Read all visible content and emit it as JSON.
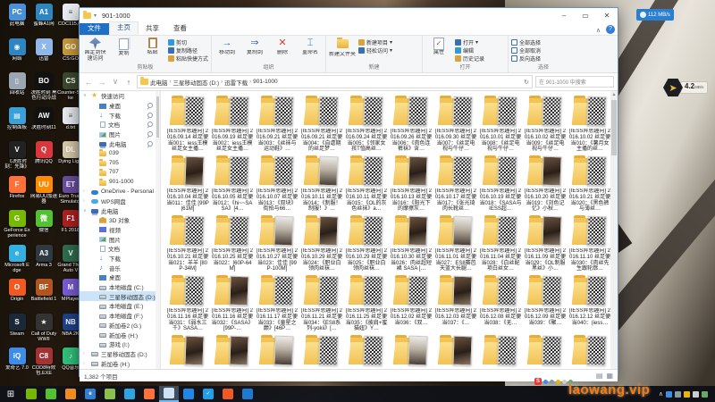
{
  "overlays": {
    "net_badge": "112 MB/s",
    "dl_speed": "4.2",
    "dl_unit": "MB/s",
    "tray_brand": "S",
    "watermark": "laowang.vip"
  },
  "window": {
    "title": "901-1000",
    "menu_file": "文件",
    "tabs": [
      "主页",
      "共享",
      "查看"
    ],
    "ribbon": {
      "clipboard": {
        "label": "剪贴板",
        "pin": "固定到快速访问",
        "copy": "复制",
        "paste": "粘贴",
        "cut": "剪切",
        "copy_path": "复制路径",
        "paste_shortcut": "粘贴快捷方式"
      },
      "organize": {
        "label": "组织",
        "move": "移动到",
        "copyto": "复制到",
        "del": "删除",
        "rename": "重命名"
      },
      "new": {
        "label": "新建",
        "folder": "新建文件夹",
        "item": "新建项目",
        "easy": "轻松访问"
      },
      "open": {
        "label": "打开",
        "props": "属性",
        "open": "打开",
        "edit": "编辑",
        "history": "历史记录"
      },
      "select": {
        "label": "选择",
        "all": "全部选择",
        "none": "全部取消",
        "invert": "反向选择"
      }
    },
    "address": {
      "crumbs": [
        "此电脑",
        "三星移动固态 (D:)",
        "迅雷下载",
        "901-1000"
      ],
      "search_placeholder": "在 901-1000 中搜索"
    },
    "status": {
      "count": "1,382 个项目"
    }
  },
  "sidebar": {
    "items": [
      {
        "t": "快速访问",
        "ic": "star",
        "ind": 0,
        "ar": "v"
      },
      {
        "t": "桌面",
        "ic": "desktop",
        "ind": 1,
        "pin": true
      },
      {
        "t": "下载",
        "ic": "download",
        "ind": 1,
        "pin": true
      },
      {
        "t": "文档",
        "ic": "doc",
        "ind": 1,
        "pin": true
      },
      {
        "t": "图片",
        "ic": "pic",
        "ind": 1,
        "pin": true
      },
      {
        "t": "此电脑",
        "ic": "pc",
        "ind": 1,
        "pin": true
      },
      {
        "t": "039",
        "ic": "folder",
        "ind": 1
      },
      {
        "t": "705",
        "ic": "folder",
        "ind": 1
      },
      {
        "t": "707",
        "ic": "folder",
        "ind": 1
      },
      {
        "t": "901-1000",
        "ic": "folder",
        "ind": 1
      },
      {
        "t": "OneDrive - Personal",
        "ic": "cloud",
        "ind": 0,
        "ar": ">"
      },
      {
        "t": "WPS网盘",
        "ic": "cloud2",
        "ind": 0,
        "ar": ">"
      },
      {
        "t": "此电脑",
        "ic": "pc",
        "ind": 0,
        "ar": "v"
      },
      {
        "t": "3D 对象",
        "ic": "obj",
        "ind": 1
      },
      {
        "t": "视频",
        "ic": "video",
        "ind": 1
      },
      {
        "t": "图片",
        "ic": "pic",
        "ind": 1
      },
      {
        "t": "文档",
        "ic": "doc",
        "ind": 1
      },
      {
        "t": "下载",
        "ic": "download",
        "ind": 1
      },
      {
        "t": "音乐",
        "ic": "music",
        "ind": 1
      },
      {
        "t": "桌面",
        "ic": "desktop",
        "ind": 1
      },
      {
        "t": "本地磁盘 (C:)",
        "ic": "drive",
        "ind": 1
      },
      {
        "t": "三星移动固态 (D:)",
        "ic": "drive",
        "ind": 1,
        "sel": true
      },
      {
        "t": "本地磁盘 (E:)",
        "ic": "drive",
        "ind": 1
      },
      {
        "t": "本地磁盘 (F:)",
        "ic": "drive",
        "ind": 1
      },
      {
        "t": "新加卷2 (G:)",
        "ic": "drive",
        "ind": 1
      },
      {
        "t": "新加卷 (H:)",
        "ic": "drive",
        "ind": 1
      },
      {
        "t": "游戏 (I:)",
        "ic": "drive",
        "ind": 1
      },
      {
        "t": "三星移动固态 (D:)",
        "ic": "drive",
        "ind": 0,
        "ar": ">"
      },
      {
        "t": "新加卷 (H:)",
        "ic": "drive",
        "ind": 0,
        "ar": ">"
      }
    ]
  },
  "files": [
    {
      "n": "[IESS异思趣向] 2016.09.14 丝足便当001：iess王模丝足女主播…",
      "t": "q"
    },
    {
      "n": "[IESS异思趣向] 2016.09.19 丝足便当002：iess王模丝足女主播…",
      "t": "q"
    },
    {
      "n": "[IESS异思趣向] 2016.09.21 丝足便当003：《丝袜与运动鞋》…",
      "t": "q"
    },
    {
      "n": "[IESS异思趣向] 2016.09.21 丝足便当004：《自虐期的丝足梦…",
      "t": "q"
    },
    {
      "n": "[IESS异思趣向] 2016.09.24 丝足便当005：《邻家女孩T恤高丝…",
      "t": "q"
    },
    {
      "n": "[IESS异思趣向] 2016.09.26 丝足便当006：《肉色连裤袜》含…",
      "t": "q"
    },
    {
      "n": "[IESS异思趣向] 2016.09.30 丝足便当007：《丝足电视与牛仔…",
      "t": "q"
    },
    {
      "n": "[IESS异思趣向] 2016.10.01 丝足便当008：《丝足电视与牛仔…",
      "t": "q"
    },
    {
      "n": "[IESS异思趣向] 2016.10.02 丝足便当009：《丝足电视与牛仔…",
      "t": "q"
    },
    {
      "n": "[IESS异思趣向] 2016.10.02 丝足便当010：《薯月女主播的丝…",
      "t": "q"
    },
    {
      "n": "[IESS异思趣向] 2016.10.04 丝足便当011：佳佳 [99P|61M]",
      "t": "pd"
    },
    {
      "n": "[IESS异思趣向] 2016.10.05 丝足便当012：《hi~~SASA》[4…",
      "t": "q"
    },
    {
      "n": "[IESS异思趣向] 2016.10.07 丝足便当013：《双块》街拍与66…",
      "t": "q"
    },
    {
      "n": "[IESS异思趣向] 2016.10.11 丝足便当014：《制服！制服！》…",
      "t": "pl"
    },
    {
      "n": "[IESS异思趣向] 2016.10.11 丝足便当015：《OL的灰色丝袜》a…",
      "t": "q"
    },
    {
      "n": "[IESS异思趣向] 2016.10.13 丝足便当016：《阳光下的摩擦灰…",
      "t": "pd"
    },
    {
      "n": "[IESS异思趣向] 2016.10.17 丝足便当017：《张光琦肉长靴丝…",
      "t": "q"
    },
    {
      "n": "[IESS异思趣向] 2016.10.19 丝足便当018：《SASA与IESS超…",
      "t": "q"
    },
    {
      "n": "[IESS异思趣向] 2016.10.20 丝足便当019：《刘色记忆》小秋…",
      "t": "pd"
    },
    {
      "n": "[IESS异思趣向] 2016.10.21 丝足便当020：《黑色裤与薄丝…",
      "t": "q"
    },
    {
      "n": "[IESS异思趣向] 2016.10.21 丝足便当021：羊羊 [80P-34M]",
      "t": "q"
    },
    {
      "n": "[IESS异思趣向] 2016.10.25 丝足便当022：[60P-64M]",
      "t": "q"
    },
    {
      "n": "[IESS异思趣向] 2016.10.27 丝足便当023：佳佳 [99P-100M]",
      "t": "pl"
    },
    {
      "n": "[IESS异思趣向] 2016.10.29 丝足便当024：《职业白领肉丝袜…",
      "t": "pd"
    },
    {
      "n": "[IESS异思趣向] 2016.10.29 丝足便当025：《职业白领肉丝袜…",
      "t": "q"
    },
    {
      "n": "[IESS异思趣向] 2016.10.30 丝足便当026：肉丝超短裙 SASA […",
      "t": "pd"
    },
    {
      "n": "[IESS异思趣向] 2016.11.01 丝足便当027：ES8赛芭天蓝大长腿…",
      "t": "pl"
    },
    {
      "n": "[IESS异思趣向] 2016.11.04 丝足便当028：《白丝配项白丝女…",
      "t": "q"
    },
    {
      "n": "[IESS异思趣向] 2016.11.09 丝足便当029：《OL制服黑丝》小…",
      "t": "pd"
    },
    {
      "n": "[IESS异思趣向] 2016.11.10 丝足便当030：《肉丝先生跟轮廓…",
      "t": "q"
    },
    {
      "n": "[IESS异思趣向] 2016.11.16 丝足便当031：《弱水三千》SASA…",
      "t": "q"
    },
    {
      "n": "[IESS异思趣向] 2016.11.16 丝足便当032：《SASA》[99P-…",
      "t": "pd"
    },
    {
      "n": "[IESS异思趣向] 2016.11.17 丝足便当033：《童星之巅》[46P…",
      "t": "q"
    },
    {
      "n": "[IESS异思趣向] 2016.11.21 丝足便当034：《ES8系列-yokii》[…",
      "t": "q"
    },
    {
      "n": "[IESS异思趣向] 2016.11.25 丝足便当035：《披肩+蜜猫妞》Y…",
      "t": "q"
    },
    {
      "n": "[IESS异思趣向] 2016.12.02 丝足便当036：《双…",
      "t": "q"
    },
    {
      "n": "[IESS异思趣向] 2016.12.03 丝足便当037：《…",
      "t": "pd"
    },
    {
      "n": "[IESS异思趣向] 2016.12.08 丝足便当038：《无…",
      "t": "q"
    },
    {
      "n": "[IESS异思趣向] 2016.12.09 丝足便当039：《聚…",
      "t": "q"
    },
    {
      "n": "[IESS异思趣向] 2016.12.12 丝足便当040：(iess…",
      "t": "q"
    },
    {
      "n": "",
      "t": "pd"
    },
    {
      "n": "",
      "t": "pd"
    },
    {
      "n": "",
      "t": "pl"
    },
    {
      "n": "",
      "t": "q"
    },
    {
      "n": "",
      "t": "q"
    },
    {
      "n": "",
      "t": "pl"
    },
    {
      "n": "",
      "t": "pd"
    },
    {
      "n": "",
      "t": "q"
    },
    {
      "n": "",
      "t": "q"
    },
    {
      "n": "",
      "t": "q"
    }
  ],
  "desktop": {
    "icons": [
      {
        "label": "此电脑",
        "c": "#4a90d9",
        "g": "PC",
        "col": 0,
        "row": 0
      },
      {
        "label": "蜜蜂A1网",
        "c": "#2e86c1",
        "g": "A1",
        "col": 1,
        "row": 0
      },
      {
        "label": "COC115.txt",
        "c": "#e8ecf0",
        "g": "≡",
        "col": 2,
        "row": 0
      },
      {
        "label": "网络",
        "c": "#2e86c1",
        "g": "◉",
        "col": 0,
        "row": 1
      },
      {
        "label": "迅雷",
        "c": "#8fb7e8",
        "g": "X",
        "col": 1,
        "row": 1
      },
      {
        "label": "CS:GO",
        "c": "#c79b3b",
        "g": "GO",
        "col": 2,
        "row": 1
      },
      {
        "label": "回收站",
        "c": "#9aa6b2",
        "g": "▯",
        "col": 0,
        "row": 2
      },
      {
        "label": "决胜时刻 黑色行动冷战",
        "c": "#111111",
        "g": "BO",
        "col": 1,
        "row": 2
      },
      {
        "label": "Counter-Strike",
        "c": "#3b4a2f",
        "g": "CS",
        "col": 2,
        "row": 2
      },
      {
        "label": "控制面板",
        "c": "#3aa0d8",
        "g": "▤",
        "col": 0,
        "row": 3
      },
      {
        "label": "决胜时刻11",
        "c": "#111111",
        "g": "AW",
        "col": 1,
        "row": 3
      },
      {
        "label": "d.txt",
        "c": "#e8ecf0",
        "g": "≡",
        "col": 2,
        "row": 3
      },
      {
        "label": "《决胜时刻：先锋》",
        "c": "#222222",
        "g": "V",
        "col": 0,
        "row": 4
      },
      {
        "label": "腾讯QQ",
        "c": "#d9363e",
        "g": "Q",
        "col": 1,
        "row": 4
      },
      {
        "label": "Dying Light",
        "c": "#d7c9a8",
        "g": "DL",
        "col": 2,
        "row": 4
      },
      {
        "label": "Firefox",
        "c": "#ff7139",
        "g": "F",
        "col": 0,
        "row": 5
      },
      {
        "label": "网易UU加速器",
        "c": "#ff8a00",
        "g": "UU",
        "col": 1,
        "row": 5
      },
      {
        "label": "Euro Truck Simulator",
        "c": "#6b4ea0",
        "g": "ET",
        "col": 2,
        "row": 5
      },
      {
        "label": "GeForce Experience",
        "c": "#76b900",
        "g": "G",
        "col": 0,
        "row": 6
      },
      {
        "label": "微信",
        "c": "#51c332",
        "g": "微",
        "col": 1,
        "row": 6
      },
      {
        "label": "F1 2018",
        "c": "#b02020",
        "g": "F1",
        "col": 2,
        "row": 6
      },
      {
        "label": "Microsoft Edge",
        "c": "#35b1e0",
        "g": "e",
        "col": 0,
        "row": 7
      },
      {
        "label": "Arma 3",
        "c": "#2f3a40",
        "g": "A3",
        "col": 1,
        "row": 7
      },
      {
        "label": "Grand Theft Auto V",
        "c": "#2f6e4f",
        "g": "V",
        "col": 2,
        "row": 7
      },
      {
        "label": "Origin",
        "c": "#f05a22",
        "g": "O",
        "col": 0,
        "row": 8
      },
      {
        "label": "Battlefield 1",
        "c": "#b3541e",
        "g": "BF",
        "col": 1,
        "row": 8
      },
      {
        "label": "MPlayer",
        "c": "#7a5cd6",
        "g": "M",
        "col": 2,
        "row": 8
      },
      {
        "label": "Steam",
        "c": "#1b2838",
        "g": "S",
        "col": 0,
        "row": 9
      },
      {
        "label": "Call of Duty WWII",
        "c": "#333333",
        "g": "★",
        "col": 1,
        "row": 9
      },
      {
        "label": "NBA 2K",
        "c": "#1d428a",
        "g": "NB",
        "col": 2,
        "row": 9
      },
      {
        "label": "爱奇艺 7.0",
        "c": "#3f8ce8",
        "g": "iQ",
        "col": 0,
        "row": 10
      },
      {
        "label": "COD8特效包.EXE",
        "c": "#a33333",
        "g": "C8",
        "col": 1,
        "row": 10
      },
      {
        "label": "QQ音乐",
        "c": "#31c27c",
        "g": "♪",
        "col": 2,
        "row": 10
      }
    ]
  },
  "taskbar": {
    "start_glyph": "⊞",
    "apps": [
      {
        "name": "geforce",
        "c": "#76b900",
        "g": ""
      },
      {
        "name": "wechat",
        "c": "#51c332",
        "g": ""
      },
      {
        "name": "app-orange",
        "c": "#f08c1e",
        "g": ""
      },
      {
        "name": "edge",
        "c": "#2f7fd4",
        "g": "e"
      },
      {
        "name": "qq-app",
        "c": "#8bc34a",
        "g": ""
      },
      {
        "name": "telegram",
        "c": "#2ca5e0",
        "g": ""
      },
      {
        "name": "firefox",
        "c": "#ff7139",
        "g": ""
      },
      {
        "name": "explorer",
        "c": "#cfe3f5",
        "g": "",
        "active": true
      },
      {
        "name": "thunder",
        "c": "#1f87e8",
        "g": ""
      },
      {
        "name": "meeting-check",
        "c": "#1fa0e8",
        "g": "✓"
      },
      {
        "name": "origin",
        "c": "#f05a22",
        "g": ""
      },
      {
        "name": "clock-app",
        "c": "#1e79d0",
        "g": ""
      }
    ],
    "tray_expand": "∧",
    "tray_dots": [
      "#3a8ee6",
      "#8899aa",
      "#e6b800",
      "#cccccc",
      "#66aa66"
    ]
  }
}
